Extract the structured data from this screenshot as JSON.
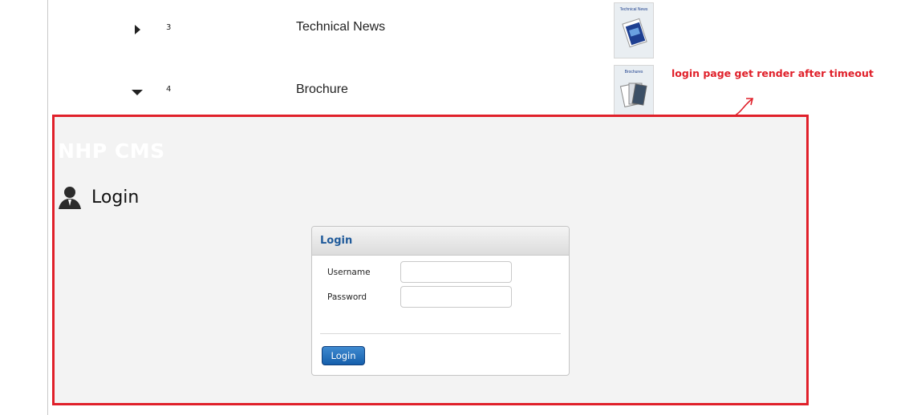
{
  "content_list": {
    "rows": [
      {
        "number": "3",
        "title": "Technical News",
        "thumbnail_label": "Technical News",
        "expander_icon": "triangle-right-icon"
      },
      {
        "number": "4",
        "title": "Brochure",
        "thumbnail_label": "Brochures",
        "expander_icon": "triangle-down-icon"
      }
    ]
  },
  "annotation": {
    "text": "login page get render after timeout",
    "color": "#e0202a"
  },
  "login_page": {
    "brand": "NHP CMS",
    "heading": "Login",
    "heading_icon": "user-icon",
    "panel_title": "Login",
    "username_label": "Username",
    "password_label": "Password",
    "username_value": "",
    "password_value": "",
    "button_label": "Login"
  },
  "colors": {
    "highlight_border": "#e0202a",
    "panel_title": "#1f5a9a",
    "button": "#1a63b0",
    "overlay_bg": "#f3f3f3"
  }
}
